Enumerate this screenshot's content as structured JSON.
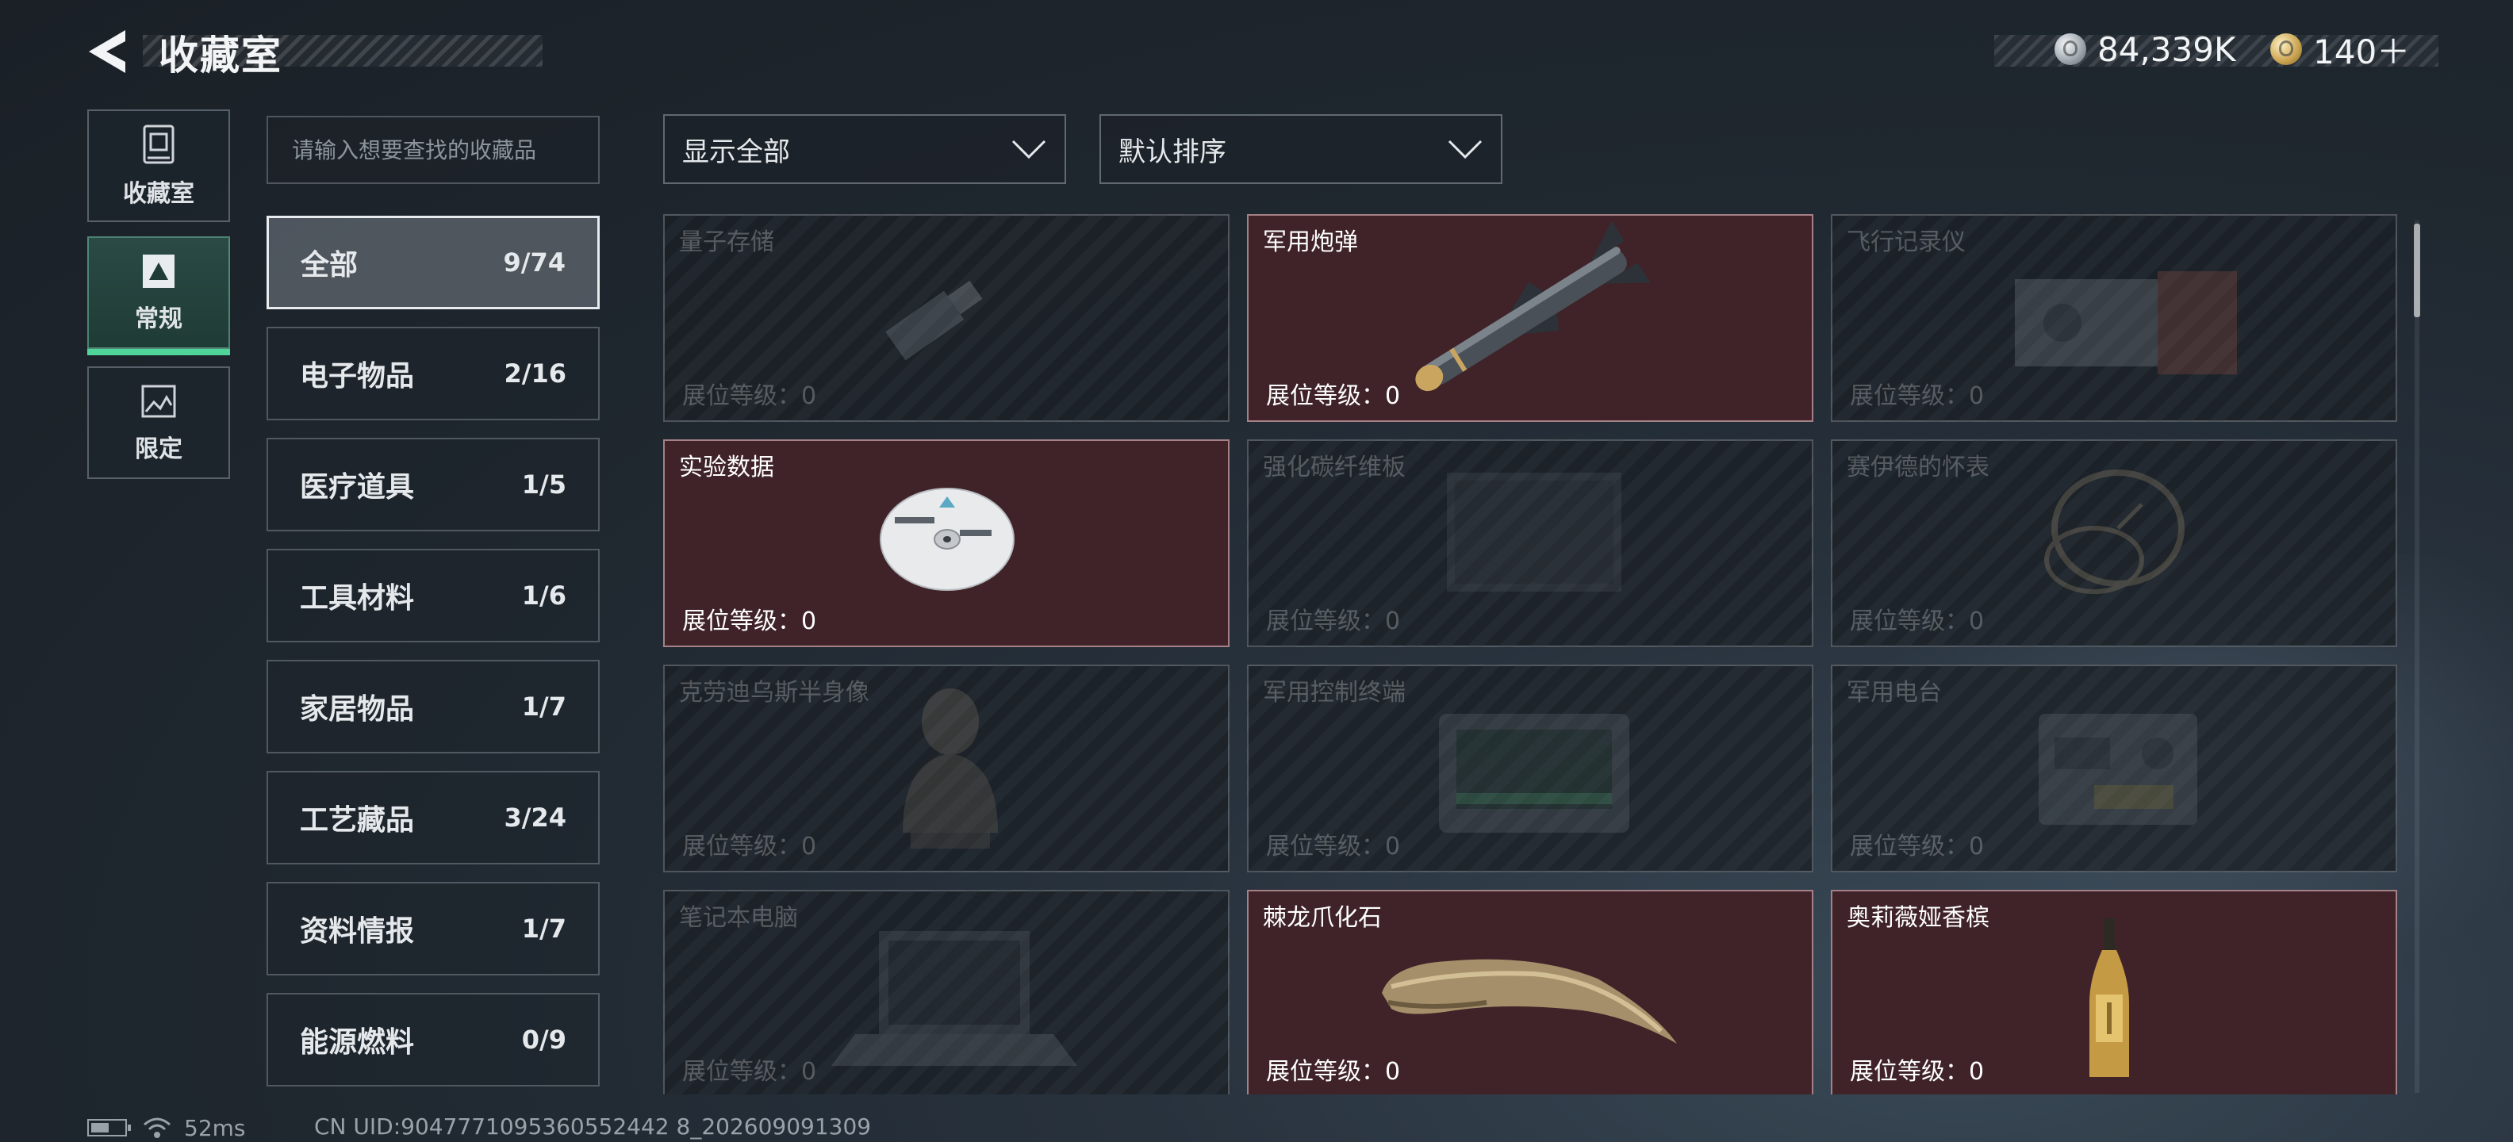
{
  "header": {
    "title": "收藏室",
    "currencies": [
      {
        "icon": "silver-coin-icon",
        "value": "84,339K"
      },
      {
        "icon": "gold-coin-icon",
        "value": "140＋"
      }
    ]
  },
  "nav": [
    {
      "label": "收藏室",
      "icon": "collection-room-icon",
      "active": false
    },
    {
      "label": "常规",
      "icon": "regular-icon",
      "active": true
    },
    {
      "label": "限定",
      "icon": "limited-icon",
      "active": false
    }
  ],
  "search": {
    "placeholder": "请输入想要查找的收藏品"
  },
  "categories": [
    {
      "name": "全部",
      "count": "9/74",
      "active": true
    },
    {
      "name": "电子物品",
      "count": "2/16"
    },
    {
      "name": "医疗道具",
      "count": "1/5"
    },
    {
      "name": "工具材料",
      "count": "1/6"
    },
    {
      "name": "家居物品",
      "count": "1/7"
    },
    {
      "name": "工艺藏品",
      "count": "3/24"
    },
    {
      "name": "资料情报",
      "count": "1/7"
    },
    {
      "name": "能源燃料",
      "count": "0/9"
    }
  ],
  "filters": {
    "display": {
      "value": "显示全部"
    },
    "sort": {
      "value": "默认排序"
    }
  },
  "items": [
    {
      "name": "量子存储",
      "level": "展位等级：0",
      "owned": false,
      "icon": "usb-drive-icon"
    },
    {
      "name": "军用炮弹",
      "level": "展位等级：0",
      "owned": true,
      "icon": "missile-icon"
    },
    {
      "name": "飞行记录仪",
      "level": "展位等级：0",
      "owned": false,
      "icon": "flight-recorder-icon"
    },
    {
      "name": "实验数据",
      "level": "展位等级：0",
      "owned": true,
      "icon": "disc-icon"
    },
    {
      "name": "强化碳纤维板",
      "level": "展位等级：0",
      "owned": false,
      "icon": "carbon-plate-icon"
    },
    {
      "name": "赛伊德的怀表",
      "level": "展位等级：0",
      "owned": false,
      "icon": "pocket-watch-icon"
    },
    {
      "name": "克劳迪乌斯半身像",
      "level": "展位等级：0",
      "owned": false,
      "icon": "bust-statue-icon"
    },
    {
      "name": "军用控制终端",
      "level": "展位等级：0",
      "owned": false,
      "icon": "control-terminal-icon"
    },
    {
      "name": "军用电台",
      "level": "展位等级：0",
      "owned": false,
      "icon": "radio-icon"
    },
    {
      "name": "笔记本电脑",
      "level": "展位等级：0",
      "owned": false,
      "icon": "laptop-icon"
    },
    {
      "name": "棘龙爪化石",
      "level": "展位等级：0",
      "owned": true,
      "icon": "claw-fossil-icon"
    },
    {
      "name": "奥莉薇娅香槟",
      "level": "展位等级：0",
      "owned": true,
      "icon": "champagne-bottle-icon"
    }
  ],
  "footer": {
    "ping": "52ms",
    "uid": "CN UID:9047771095360552442 8_202609091309"
  },
  "colors": {
    "owned_card": "#3f2328",
    "active_tab_underline": "#4fd49a"
  }
}
